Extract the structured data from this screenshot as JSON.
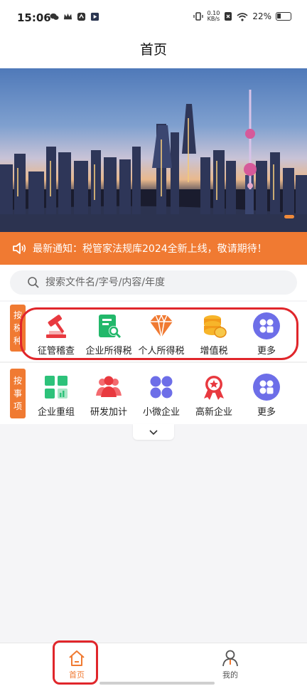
{
  "status_bar": {
    "time": "15:06",
    "net_speed_value": "0.10",
    "net_speed_unit": "KB/s",
    "battery": "22%"
  },
  "header": {
    "title": "首页"
  },
  "notice": {
    "text": "最新通知：税管家法规库2024全新上线，敬请期待！"
  },
  "search": {
    "placeholder": "搜索文件名/字号/内容/年度"
  },
  "row1": {
    "tab_chars": [
      "按",
      "税",
      "种"
    ],
    "items": [
      {
        "label": "征管稽查",
        "icon": "gavel-icon"
      },
      {
        "label": "企业所得税",
        "icon": "document-search-icon"
      },
      {
        "label": "个人所得税",
        "icon": "diamond-icon"
      },
      {
        "label": "增值税",
        "icon": "coins-icon"
      },
      {
        "label": "更多",
        "icon": "more-grid-icon"
      }
    ]
  },
  "row2": {
    "tab_chars": [
      "按",
      "事",
      "项"
    ],
    "items": [
      {
        "label": "企业重组",
        "icon": "grid-chart-icon"
      },
      {
        "label": "研发加计",
        "icon": "team-icon"
      },
      {
        "label": "小微企业",
        "icon": "four-dots-icon"
      },
      {
        "label": "高新企业",
        "icon": "medal-icon"
      },
      {
        "label": "更多",
        "icon": "more-grid-icon"
      }
    ]
  },
  "bottom_nav": {
    "home_label": "首页",
    "me_label": "我的"
  },
  "colors": {
    "accent": "#f07a32",
    "highlight": "#e0262b"
  }
}
